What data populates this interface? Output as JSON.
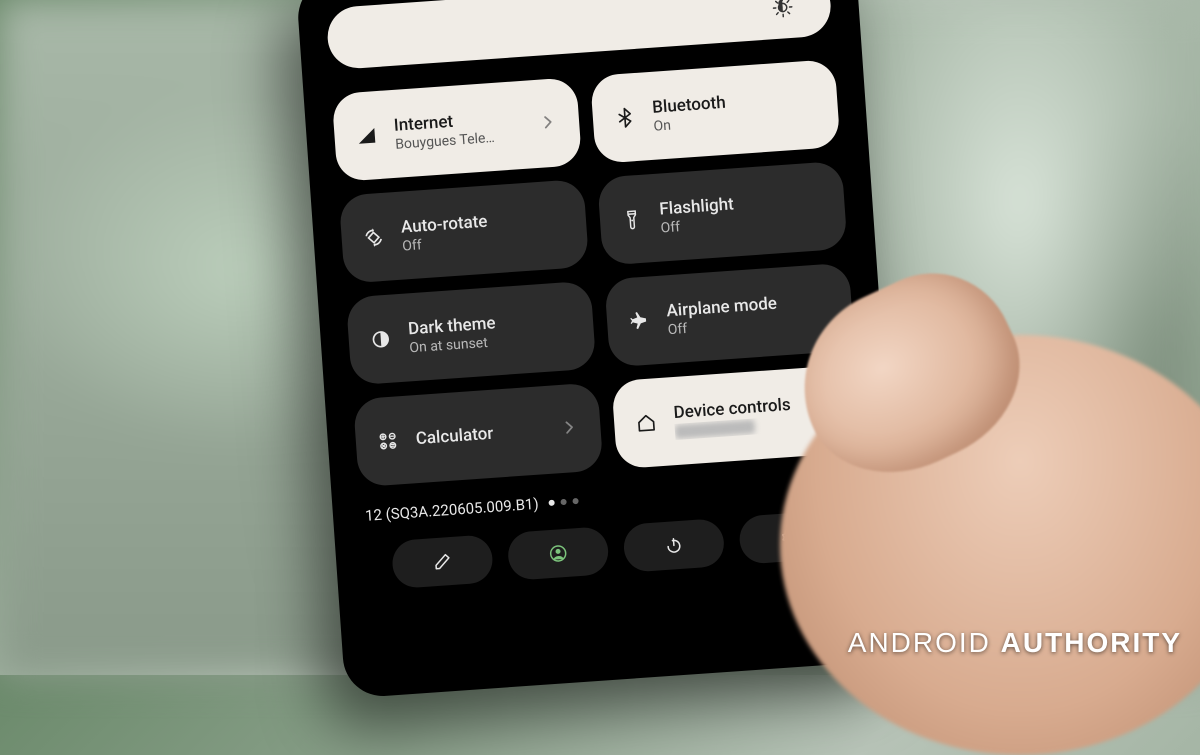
{
  "brightness_icon": "brightness-medium",
  "tiles": [
    {
      "id": "internet",
      "title": "Internet",
      "sub": "Bouygues Tele…",
      "state": "on",
      "icon": "signal",
      "chevron": true
    },
    {
      "id": "bluetooth",
      "title": "Bluetooth",
      "sub": "On",
      "state": "on",
      "icon": "bluetooth",
      "chevron": false
    },
    {
      "id": "autorotate",
      "title": "Auto-rotate",
      "sub": "Off",
      "state": "off",
      "icon": "rotate",
      "chevron": false
    },
    {
      "id": "flashlight",
      "title": "Flashlight",
      "sub": "Off",
      "state": "off",
      "icon": "flashlight",
      "chevron": false
    },
    {
      "id": "darktheme",
      "title": "Dark theme",
      "sub": "On at sunset",
      "state": "off",
      "icon": "darktheme",
      "chevron": false
    },
    {
      "id": "airplane",
      "title": "Airplane mode",
      "sub": "Off",
      "state": "off",
      "icon": "airplane",
      "chevron": false
    },
    {
      "id": "calculator",
      "title": "Calculator",
      "sub": "",
      "state": "off",
      "icon": "calculator",
      "chevron": true
    },
    {
      "id": "devicecontrols",
      "title": "Device controls",
      "sub": "",
      "state": "on",
      "icon": "home",
      "chevron": true,
      "blurred_sub": true
    }
  ],
  "build_text": "12 (SQ3A.220605.009.B1)",
  "page_dots": {
    "count": 3,
    "active": 0
  },
  "actions": {
    "edit": "edit",
    "user": "user",
    "power": "power",
    "settings": "settings"
  },
  "watermark": {
    "part1": "ANDROID",
    "part2": "AUTHORITY"
  },
  "colors": {
    "tile_on_bg": "#f0ece6",
    "tile_off_bg": "#2c2c2c",
    "accent_user": "#7cc47c"
  }
}
